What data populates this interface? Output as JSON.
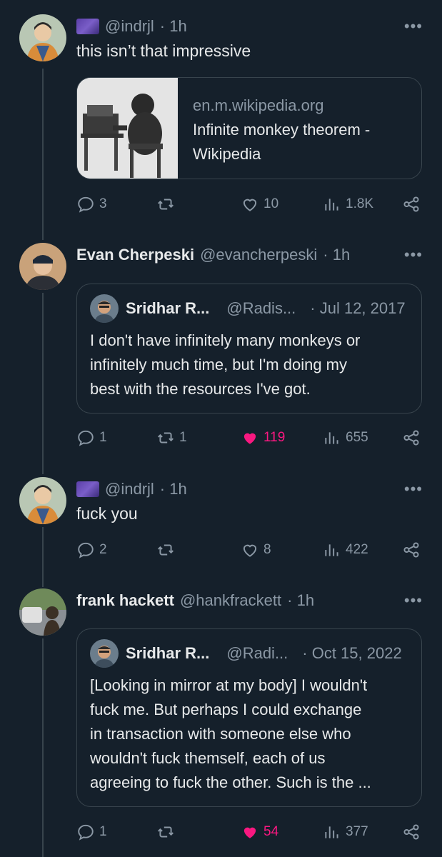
{
  "tweets": [
    {
      "handle": "@indrjl",
      "time": "· 1h",
      "text": "this isn’t that impressive",
      "card": {
        "domain": "en.m.wikipedia.org",
        "title_line1": "Infinite monkey theorem -",
        "title_line2": "Wikipedia"
      },
      "actions": {
        "replies": "3",
        "retweets": "",
        "likes": "10",
        "views": "1.8K"
      }
    },
    {
      "name": "Evan Cherpeski",
      "handle": "@evancherpeski",
      "time": "· 1h",
      "quote": {
        "name": "Sridhar R...",
        "handle": "@Radis...",
        "date": "· Jul 12, 2017",
        "line1": "I don't have infinitely many monkeys or",
        "line2": "infinitely much time, but I'm doing my",
        "line3": "best with the resources I've got."
      },
      "actions": {
        "replies": "1",
        "retweets": "1",
        "likes": "119",
        "views": "655"
      }
    },
    {
      "handle": "@indrjl",
      "time": "· 1h",
      "text": "fuck you",
      "actions": {
        "replies": "2",
        "retweets": "",
        "likes": "8",
        "views": "422"
      }
    },
    {
      "name": "frank hackett",
      "handle": "@hankfrackett",
      "time": "· 1h",
      "quote": {
        "name": "Sridhar R...",
        "handle": "@Radi...",
        "date": "· Oct 15, 2022",
        "line1": "[Looking in mirror at my body] I wouldn't",
        "line2": "fuck me. But perhaps I could exchange",
        "line3": "in transaction with someone else who",
        "line4": "wouldn't fuck themself, each of us",
        "line5": "agreeing to fuck the other. Such is the ..."
      },
      "actions": {
        "replies": "1",
        "retweets": "",
        "likes": "54",
        "views": "377"
      }
    }
  ],
  "icons": {
    "more": "more-horizontal-icon",
    "reply": "reply-icon",
    "retweet": "retweet-icon",
    "like": "heart-icon",
    "views": "views-icon",
    "share": "share-icon"
  },
  "colors": {
    "background": "#15202b",
    "text": "#e7e9ea",
    "muted": "#8b98a5",
    "like": "#f91880",
    "border": "#38444d"
  }
}
